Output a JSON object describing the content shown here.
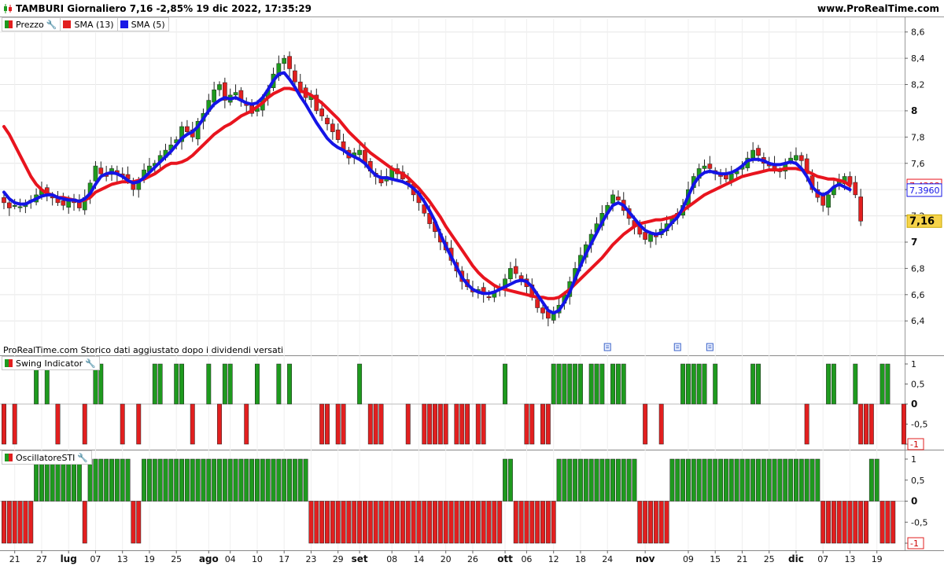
{
  "header": {
    "title": "TAMBURI Giornaliero 7,16 -2,85% 19 dic 2022, 17:35:29",
    "site": "www.ProRealTime.com"
  },
  "legend_main": [
    {
      "label": "Prezzo",
      "swatch": "price",
      "wrench": true
    },
    {
      "label": "SMA (13)",
      "swatch": "red",
      "wrench": false
    },
    {
      "label": "SMA (5)",
      "swatch": "blue",
      "wrench": false
    }
  ],
  "legend_swing": "Swing Indicator",
  "legend_sti": "OscillatoreSTI",
  "note": "ProRealTime.com Storico dati aggiustato dopo i dividendi versati",
  "colors": {
    "up": "#1e9a1e",
    "down": "#e21f1f",
    "sma13": "#e8141e",
    "sma5": "#1414e6",
    "grid": "#e6e6e6"
  },
  "chart_data": [
    {
      "type": "candlestick",
      "title": "TAMBURI Giornaliero",
      "ylim": [
        6.15,
        8.7
      ],
      "y_ticks": [
        6.4,
        6.6,
        6.8,
        7,
        7.2,
        7.4,
        7.6,
        7.8,
        8,
        8.2,
        8.4,
        8.6
      ],
      "last_price": "7,16",
      "sma13_last": "7,4308",
      "sma5_last": "7,3960",
      "x_labels": [
        {
          "i": 2,
          "label": "21",
          "bold": false
        },
        {
          "i": 7,
          "label": "27",
          "bold": false
        },
        {
          "i": 12,
          "label": "lug",
          "bold": true
        },
        {
          "i": 17,
          "label": "07",
          "bold": false
        },
        {
          "i": 22,
          "label": "13",
          "bold": false
        },
        {
          "i": 27,
          "label": "19",
          "bold": false
        },
        {
          "i": 32,
          "label": "25",
          "bold": false
        },
        {
          "i": 38,
          "label": "ago",
          "bold": true
        },
        {
          "i": 42,
          "label": "04",
          "bold": false
        },
        {
          "i": 47,
          "label": "10",
          "bold": false
        },
        {
          "i": 52,
          "label": "17",
          "bold": false
        },
        {
          "i": 57,
          "label": "23",
          "bold": false
        },
        {
          "i": 62,
          "label": "29",
          "bold": false
        },
        {
          "i": 66,
          "label": "set",
          "bold": true
        },
        {
          "i": 72,
          "label": "08",
          "bold": false
        },
        {
          "i": 77,
          "label": "14",
          "bold": false
        },
        {
          "i": 82,
          "label": "20",
          "bold": false
        },
        {
          "i": 87,
          "label": "26",
          "bold": false
        },
        {
          "i": 93,
          "label": "ott",
          "bold": true
        },
        {
          "i": 97,
          "label": "06",
          "bold": false
        },
        {
          "i": 102,
          "label": "12",
          "bold": false
        },
        {
          "i": 107,
          "label": "18",
          "bold": false
        },
        {
          "i": 112,
          "label": "24",
          "bold": false
        },
        {
          "i": 119,
          "label": "nov",
          "bold": true
        },
        {
          "i": 127,
          "label": "09",
          "bold": false
        },
        {
          "i": 132,
          "label": "15",
          "bold": false
        },
        {
          "i": 137,
          "label": "21",
          "bold": false
        },
        {
          "i": 142,
          "label": "25",
          "bold": false
        },
        {
          "i": 147,
          "label": "dic",
          "bold": true
        },
        {
          "i": 152,
          "label": "07",
          "bold": false
        },
        {
          "i": 157,
          "label": "13",
          "bold": false
        },
        {
          "i": 162,
          "label": "19",
          "bold": false
        }
      ],
      "dividend_markers": [
        112,
        125,
        131
      ],
      "close": [
        7.3,
        7.26,
        7.28,
        7.27,
        7.3,
        7.32,
        7.36,
        7.4,
        7.36,
        7.34,
        7.3,
        7.28,
        7.33,
        7.3,
        7.26,
        7.34,
        7.45,
        7.58,
        7.52,
        7.5,
        7.56,
        7.52,
        7.5,
        7.48,
        7.4,
        7.46,
        7.55,
        7.58,
        7.6,
        7.66,
        7.7,
        7.74,
        7.78,
        7.88,
        7.84,
        7.8,
        7.92,
        7.98,
        8.08,
        8.16,
        8.2,
        8.08,
        8.12,
        8.14,
        8.08,
        8.04,
        7.98,
        8.02,
        8.1,
        8.16,
        8.28,
        8.36,
        8.4,
        8.32,
        8.22,
        8.16,
        8.1,
        8.12,
        8.0,
        7.96,
        7.9,
        7.84,
        7.78,
        7.7,
        7.64,
        7.68,
        7.7,
        7.6,
        7.54,
        7.5,
        7.45,
        7.5,
        7.56,
        7.52,
        7.48,
        7.44,
        7.36,
        7.3,
        7.22,
        7.14,
        7.08,
        7.0,
        6.94,
        6.86,
        6.78,
        6.7,
        6.66,
        6.62,
        6.64,
        6.6,
        6.58,
        6.62,
        6.66,
        6.72,
        6.8,
        6.76,
        6.72,
        6.66,
        6.58,
        6.5,
        6.46,
        6.42,
        6.46,
        6.52,
        6.6,
        6.7,
        6.8,
        6.9,
        6.98,
        7.06,
        7.14,
        7.22,
        7.28,
        7.36,
        7.32,
        7.24,
        7.18,
        7.12,
        7.06,
        7.02,
        7.06,
        7.04,
        7.1,
        7.14,
        7.18,
        7.22,
        7.28,
        7.4,
        7.5,
        7.56,
        7.58,
        7.56,
        7.52,
        7.5,
        7.48,
        7.52,
        7.54,
        7.58,
        7.64,
        7.7,
        7.66,
        7.6,
        7.58,
        7.56,
        7.54,
        7.6,
        7.64,
        7.66,
        7.62,
        7.52,
        7.4,
        7.34,
        7.28,
        7.36,
        7.42,
        7.46,
        7.5,
        7.44,
        7.36,
        7.16
      ],
      "sma13": [
        7.88,
        7.82,
        7.74,
        7.66,
        7.58,
        7.5,
        7.44,
        7.4,
        7.37,
        7.36,
        7.34,
        7.34,
        7.33,
        7.32,
        7.31,
        7.32,
        7.34,
        7.38,
        7.4,
        7.42,
        7.44,
        7.45,
        7.46,
        7.46,
        7.46,
        7.47,
        7.48,
        7.5,
        7.52,
        7.55,
        7.58,
        7.6,
        7.6,
        7.61,
        7.63,
        7.66,
        7.7,
        7.74,
        7.78,
        7.82,
        7.85,
        7.88,
        7.9,
        7.93,
        7.96,
        7.98,
        8.0,
        8.03,
        8.06,
        8.1,
        8.13,
        8.15,
        8.17,
        8.17,
        8.16,
        8.15,
        8.14,
        8.12,
        8.09,
        8.06,
        8.02,
        7.98,
        7.94,
        7.89,
        7.84,
        7.8,
        7.76,
        7.72,
        7.68,
        7.65,
        7.62,
        7.59,
        7.56,
        7.54,
        7.52,
        7.49,
        7.45,
        7.41,
        7.36,
        7.31,
        7.25,
        7.19,
        7.12,
        7.06,
        7.0,
        6.94,
        6.88,
        6.82,
        6.77,
        6.73,
        6.7,
        6.67,
        6.65,
        6.64,
        6.63,
        6.62,
        6.61,
        6.6,
        6.59,
        6.58,
        6.58,
        6.57,
        6.57,
        6.58,
        6.61,
        6.64,
        6.68,
        6.72,
        6.76,
        6.8,
        6.84,
        6.88,
        6.93,
        6.98,
        7.02,
        7.06,
        7.09,
        7.12,
        7.14,
        7.15,
        7.16,
        7.17,
        7.17,
        7.18,
        7.19,
        7.21,
        7.24,
        7.27,
        7.3,
        7.33,
        7.36,
        7.38,
        7.4,
        7.42,
        7.44,
        7.46,
        7.48,
        7.5,
        7.51,
        7.52,
        7.53,
        7.54,
        7.55,
        7.55,
        7.55,
        7.56,
        7.56,
        7.56,
        7.55,
        7.54,
        7.52,
        7.5,
        7.49,
        7.48,
        7.48,
        7.47,
        7.46,
        7.43
      ],
      "sma5": [
        7.38,
        7.33,
        7.3,
        7.29,
        7.29,
        7.31,
        7.33,
        7.35,
        7.36,
        7.36,
        7.34,
        7.33,
        7.32,
        7.32,
        7.31,
        7.33,
        7.37,
        7.44,
        7.5,
        7.52,
        7.53,
        7.52,
        7.5,
        7.47,
        7.45,
        7.46,
        7.49,
        7.53,
        7.57,
        7.61,
        7.65,
        7.69,
        7.74,
        7.79,
        7.82,
        7.84,
        7.88,
        7.94,
        8.0,
        8.05,
        8.08,
        8.1,
        8.09,
        8.1,
        8.08,
        8.06,
        8.05,
        8.06,
        8.1,
        8.16,
        8.23,
        8.28,
        8.29,
        8.24,
        8.18,
        8.11,
        8.05,
        7.98,
        7.91,
        7.85,
        7.79,
        7.75,
        7.72,
        7.7,
        7.67,
        7.65,
        7.63,
        7.6,
        7.55,
        7.51,
        7.49,
        7.49,
        7.48,
        7.47,
        7.46,
        7.44,
        7.41,
        7.37,
        7.31,
        7.24,
        7.16,
        7.06,
        6.97,
        6.89,
        6.81,
        6.73,
        6.68,
        6.64,
        6.62,
        6.61,
        6.61,
        6.62,
        6.64,
        6.66,
        6.68,
        6.7,
        6.71,
        6.7,
        6.66,
        6.6,
        6.54,
        6.48,
        6.46,
        6.48,
        6.54,
        6.62,
        6.72,
        6.82,
        6.91,
        6.99,
        7.07,
        7.15,
        7.22,
        7.28,
        7.3,
        7.28,
        7.23,
        7.18,
        7.13,
        7.09,
        7.07,
        7.06,
        7.07,
        7.1,
        7.15,
        7.19,
        7.26,
        7.35,
        7.44,
        7.5,
        7.53,
        7.54,
        7.53,
        7.52,
        7.52,
        7.53,
        7.55,
        7.58,
        7.62,
        7.63,
        7.63,
        7.62,
        7.6,
        7.59,
        7.59,
        7.6,
        7.61,
        7.6,
        7.56,
        7.5,
        7.42,
        7.38,
        7.36,
        7.38,
        7.42,
        7.44,
        7.42,
        7.4
      ]
    },
    {
      "type": "bar",
      "title": "Swing Indicator",
      "ylim": [
        -1,
        1
      ],
      "y_ticks": [
        "1",
        "0,5",
        "0",
        "-0,5",
        "-1"
      ],
      "values": [
        -1,
        0,
        -1,
        0,
        0,
        0,
        1,
        0,
        1,
        0,
        -1,
        0,
        0,
        0,
        0,
        -1,
        0,
        1,
        1,
        0,
        0,
        0,
        -1,
        0,
        0,
        -1,
        0,
        0,
        1,
        1,
        0,
        0,
        1,
        1,
        0,
        -1,
        0,
        0,
        1,
        0,
        -1,
        1,
        1,
        0,
        0,
        -1,
        0,
        1,
        0,
        0,
        0,
        1,
        0,
        1,
        0,
        0,
        0,
        0,
        0,
        -1,
        -1,
        0,
        -1,
        -1,
        0,
        0,
        1,
        0,
        -1,
        -1,
        -1,
        0,
        0,
        0,
        0,
        -1,
        0,
        0,
        -1,
        -1,
        -1,
        -1,
        -1,
        0,
        -1,
        -1,
        -1,
        0,
        -1,
        -1,
        0,
        0,
        0,
        1,
        0,
        0,
        0,
        -1,
        -1,
        0,
        -1,
        -1,
        1,
        1,
        1,
        1,
        1,
        1,
        0,
        1,
        1,
        1,
        0,
        1,
        1,
        1,
        0,
        0,
        0,
        -1,
        0,
        0,
        -1,
        0,
        0,
        0,
        1,
        1,
        1,
        1,
        1,
        0,
        1,
        0,
        0,
        0,
        0,
        0,
        0,
        1,
        1,
        0,
        0,
        0,
        0,
        0,
        0,
        0,
        0,
        -1,
        0,
        0,
        0,
        1,
        1,
        0,
        0,
        0,
        1,
        -1,
        -1,
        -1,
        0,
        1,
        1,
        0,
        0,
        -1
      ]
    },
    {
      "type": "bar",
      "title": "OscillatoreSTI",
      "ylim": [
        -1,
        1
      ],
      "y_ticks": [
        "1",
        "0,5",
        "0",
        "-0,5",
        "-1"
      ],
      "values": [
        -1,
        -1,
        -1,
        -1,
        -1,
        -1,
        1,
        1,
        1,
        1,
        1,
        1,
        1,
        1,
        1,
        -1,
        1,
        1,
        1,
        1,
        1,
        1,
        1,
        1,
        -1,
        -1,
        1,
        1,
        1,
        1,
        1,
        1,
        1,
        1,
        1,
        1,
        1,
        1,
        1,
        1,
        1,
        1,
        1,
        1,
        1,
        1,
        1,
        1,
        1,
        1,
        1,
        1,
        1,
        1,
        1,
        1,
        1,
        -1,
        -1,
        -1,
        -1,
        -1,
        -1,
        -1,
        -1,
        -1,
        -1,
        -1,
        -1,
        -1,
        -1,
        -1,
        -1,
        -1,
        -1,
        -1,
        -1,
        -1,
        -1,
        -1,
        -1,
        -1,
        -1,
        -1,
        -1,
        -1,
        -1,
        -1,
        -1,
        -1,
        -1,
        -1,
        -1,
        1,
        1,
        -1,
        -1,
        -1,
        -1,
        -1,
        -1,
        -1,
        -1,
        1,
        1,
        1,
        1,
        1,
        1,
        1,
        1,
        1,
        1,
        1,
        1,
        1,
        1,
        1,
        -1,
        -1,
        -1,
        -1,
        -1,
        -1,
        1,
        1,
        1,
        1,
        1,
        1,
        1,
        1,
        1,
        1,
        1,
        1,
        1,
        1,
        1,
        1,
        1,
        1,
        1,
        1,
        1,
        1,
        1,
        1,
        1,
        1,
        1,
        1,
        -1,
        -1,
        -1,
        -1,
        -1,
        -1,
        -1,
        -1,
        -1,
        1,
        1,
        -1,
        -1,
        -1
      ]
    }
  ]
}
